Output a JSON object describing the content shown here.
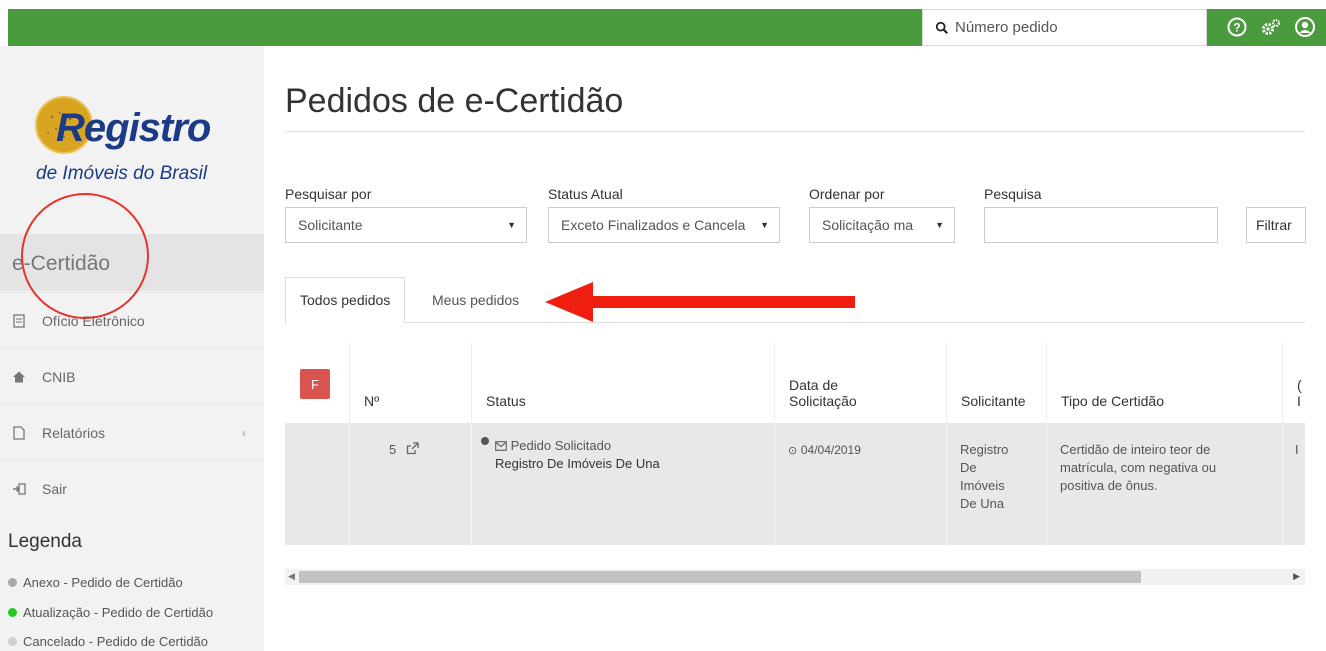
{
  "topbar": {
    "search_placeholder": "Número pedido",
    "icons": [
      "help-icon",
      "settings-icon",
      "user-icon"
    ]
  },
  "sidebar": {
    "logo_word": "Registro",
    "logo_sub": "de Imóveis do Brasil",
    "section_title": "e-Certidão",
    "items": [
      {
        "label": "Ofício Eletrônico",
        "icon": "document-icon"
      },
      {
        "label": "CNIB",
        "icon": "home-icon"
      },
      {
        "label": "Relatórios",
        "icon": "file-icon",
        "chevron": "‹"
      },
      {
        "label": "Sair",
        "icon": "signout-icon"
      }
    ],
    "legend_title": "Legenda",
    "legend": [
      {
        "label": "Anexo - Pedido de Certidão",
        "color": "#a9a9a9"
      },
      {
        "label": "Atualização - Pedido de Certidão",
        "color": "#22cc22"
      },
      {
        "label": "Cancelado - Pedido de Certidão",
        "color": "#d0d0d0"
      }
    ]
  },
  "main": {
    "title": "Pedidos de e-Certidão",
    "filters": {
      "search_by_label": "Pesquisar por",
      "search_by_value": "Solicitante",
      "status_label": "Status Atual",
      "status_value": "Exceto Finalizados e Cancela",
      "order_label": "Ordenar por",
      "order_value": "Solicitação ma",
      "query_label": "Pesquisa",
      "query_value": "",
      "filter_button": "Filtrar"
    },
    "tabs": [
      {
        "label": "Todos pedidos",
        "active": true
      },
      {
        "label": "Meus pedidos",
        "active": false
      }
    ],
    "table": {
      "badge": "F",
      "headers": {
        "number": "Nº",
        "status": "Status",
        "date_line1": "Data de",
        "date_line2": "Solicitação",
        "requester": "Solicitante",
        "type": "Tipo de Certidão",
        "extra_line1": "(",
        "extra_line2": "I"
      },
      "rows": [
        {
          "number": "5",
          "status": "Pedido Solicitado",
          "office": "Registro De Imóveis De Una",
          "date": "04/04/2019",
          "requester_lines": [
            "Registro",
            "De",
            "Imóveis",
            "De Una"
          ],
          "type_lines": [
            "Certidão de inteiro teor de",
            "matrícula, com negativa ou",
            "positiva de ônus."
          ],
          "extra": "I"
        }
      ]
    }
  },
  "colors": {
    "topbar": "#4a9a3e",
    "annotation": "#e8322a",
    "badge": "#d9534f",
    "logo_blue": "#1b3b86",
    "logo_gold": "#d9a520"
  }
}
